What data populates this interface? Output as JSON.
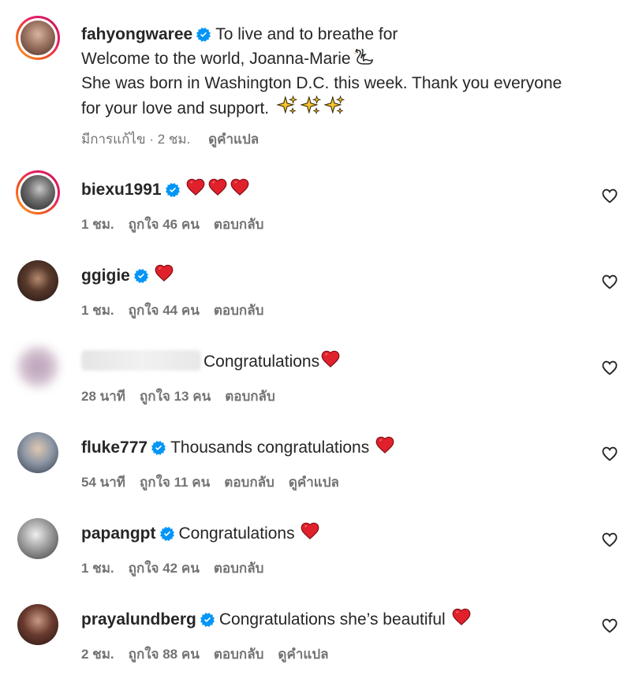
{
  "caption": {
    "username": "fahyongwaree",
    "line1": "To live and to breathe for",
    "line2": "Welcome to the world, Joanna-Marie",
    "line3": "She was born in Washington D.C. this week. Thank you everyone",
    "line4": "for your love and support.",
    "meta_edited": "มีการแก้ไข · 2 ชม.",
    "meta_translate": "ดูคำแปล"
  },
  "comments": [
    {
      "username": "biexu1991",
      "text": "",
      "time": "1 ชม.",
      "likes": "ถูกใจ 46 คน",
      "reply": "ตอบกลับ",
      "translate": ""
    },
    {
      "username": "ggigie",
      "text": "",
      "time": "1 ชม.",
      "likes": "ถูกใจ 44 คน",
      "reply": "ตอบกลับ",
      "translate": ""
    },
    {
      "username": "",
      "text": "Congratulations",
      "time": "28 นาที",
      "likes": "ถูกใจ 13 คน",
      "reply": "ตอบกลับ",
      "translate": ""
    },
    {
      "username": "fluke777",
      "text": "Thousands congratulations",
      "time": "54 นาที",
      "likes": "ถูกใจ 11 คน",
      "reply": "ตอบกลับ",
      "translate": "ดูคำแปล"
    },
    {
      "username": "papangpt",
      "text": "Congratulations",
      "time": "1 ชม.",
      "likes": "ถูกใจ 42 คน",
      "reply": "ตอบกลับ",
      "translate": ""
    },
    {
      "username": "prayalundberg",
      "text": "Congratulations she’s beautiful",
      "time": "2 ชม.",
      "likes": "ถูกใจ 88 คน",
      "reply": "ตอบกลับ",
      "translate": "ดูคำแปล"
    }
  ],
  "icons": {
    "verified": "verified-badge-icon",
    "heart": "red-heart-icon",
    "like": "heart-outline-icon",
    "sparkles": "sparkles-icon",
    "swan": "swan-icon"
  },
  "colors": {
    "verified_blue": "#0095f6",
    "heart_red": "#e0212c",
    "meta_gray": "#737373",
    "text": "#262626"
  }
}
